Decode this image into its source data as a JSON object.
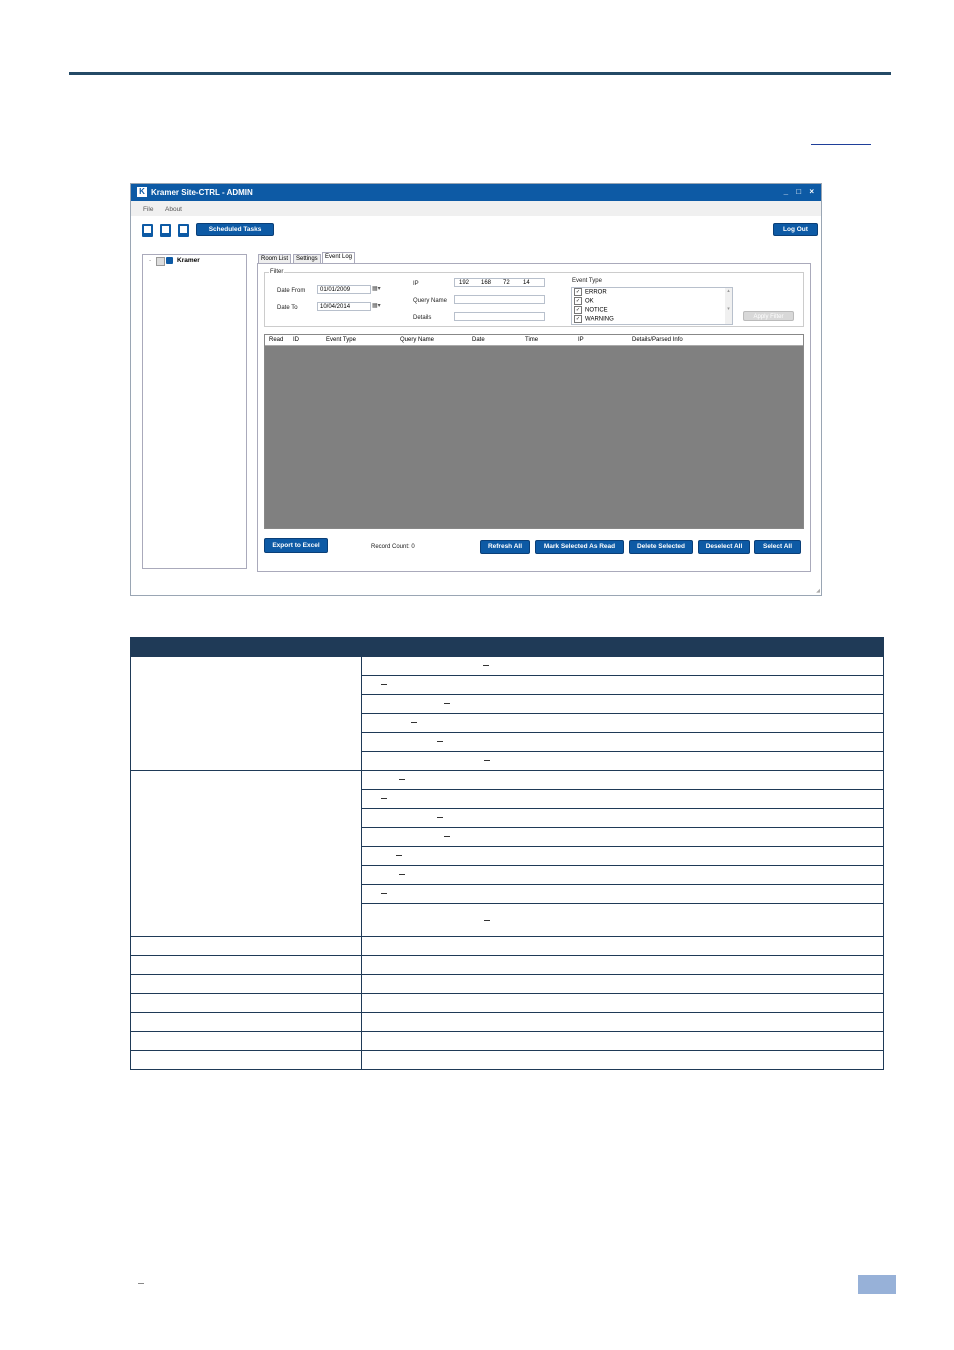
{
  "window": {
    "title": "Kramer Site-CTRL - ADMIN",
    "logo_letter": "K",
    "controls": "_ □ ×"
  },
  "menu": {
    "file": "File",
    "about": "About"
  },
  "toolbar": {
    "scheduled_tasks": "Scheduled Tasks",
    "log_out": "Log Out"
  },
  "tree": {
    "root_label": "Kramer",
    "expander": "-"
  },
  "tabs": [
    {
      "label": "Room List"
    },
    {
      "label": "Settings"
    },
    {
      "label": "Event Log"
    }
  ],
  "filter": {
    "legend": "Filter",
    "date_from_label": "Date From",
    "date_from_value": "01/01/2009",
    "date_to_label": "Date To",
    "date_to_value": "10/04/2014",
    "ip_label": "IP",
    "ip_octets": [
      "192",
      "168",
      "72",
      "14"
    ],
    "query_name_label": "Query Name",
    "query_name_value": "",
    "details_label": "Details",
    "details_value": "",
    "event_type_label": "Event Type",
    "event_types": [
      {
        "label": "ERROR",
        "checked": true
      },
      {
        "label": "OK",
        "checked": true
      },
      {
        "label": "NOTICE",
        "checked": true
      },
      {
        "label": "WARNING",
        "checked": true
      }
    ],
    "apply_filter": "Apply Filter"
  },
  "grid": {
    "columns": [
      "Read",
      "ID",
      "Event Type",
      "Query Name",
      "Date",
      "Time",
      "IP",
      "Details/Parsed Info"
    ]
  },
  "bottom": {
    "export": "Export to Excel",
    "record_count": "Record Count: 0",
    "refresh_all": "Refresh All",
    "mark_read": "Mark Selected As Read",
    "delete_selected": "Delete Selected",
    "deselect_all": "Deselect All",
    "select_all": "Select All"
  },
  "colors": {
    "brand": "#0d5aa5",
    "table_header": "#1f3a57",
    "grid_bg": "#808080",
    "footer_box": "#97b1d8"
  }
}
